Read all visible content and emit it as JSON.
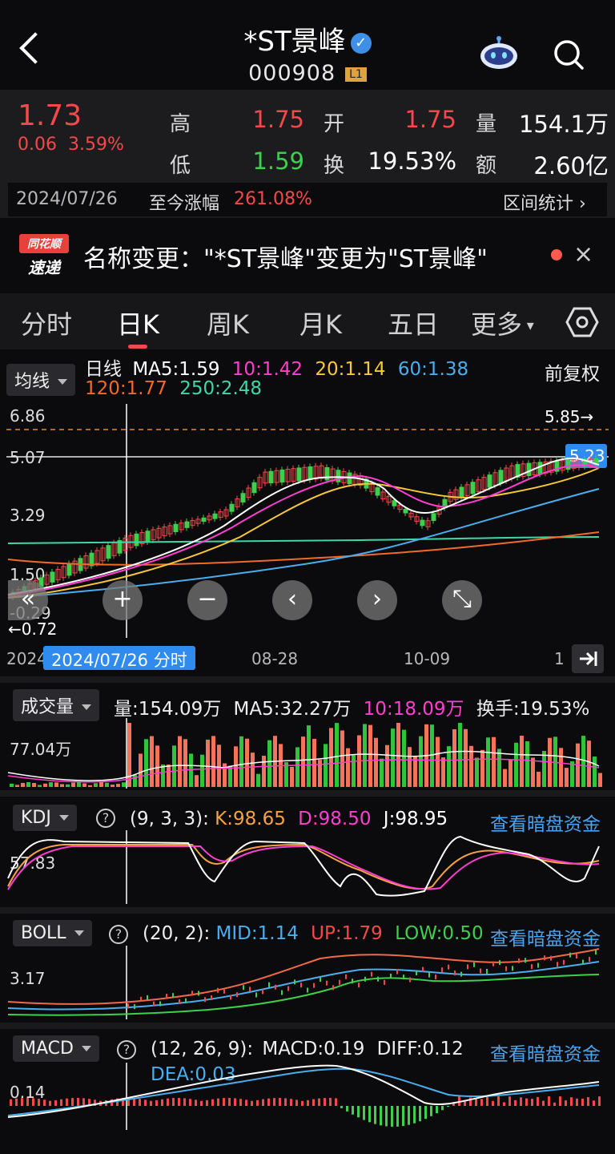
{
  "header": {
    "title": "*ST景峰",
    "code": "000908",
    "level_badge": "L1"
  },
  "quote": {
    "price": "1.73",
    "change": "0.06",
    "change_pct": "3.59%",
    "high_label": "高",
    "high": "1.75",
    "open_label": "开",
    "open": "1.75",
    "volume_label": "量",
    "volume": "154.1万",
    "low_label": "低",
    "low": "1.59",
    "turnover_label": "换",
    "turnover": "19.53%",
    "amount_label": "额",
    "amount": "2.60亿",
    "date": "2024/07/26",
    "since_label": "至今涨幅",
    "since_value": "261.08%",
    "range_stats": "区间统计"
  },
  "news": {
    "badge_top": "同花顺",
    "badge_bottom": "速递",
    "text": "名称变更：\"*ST景峰\"变更为\"ST景峰\""
  },
  "tabs": [
    "分时",
    "日K",
    "周K",
    "月K",
    "五日",
    "更多"
  ],
  "ma_panel": {
    "selector": "均线",
    "label": "日线",
    "ma5": "MA5:1.59",
    "ma10": "10:1.42",
    "ma20": "20:1.14",
    "ma60": "60:1.38",
    "ma120": "120:1.77",
    "ma250": "250:2.48",
    "adjust": "前复权",
    "y_labels": [
      "6.86",
      "5.07",
      "3.29",
      "1.50",
      "-0.29"
    ],
    "hi_marker": "5.85",
    "price_tag": "5.23",
    "lo_marker": "0.72",
    "colors": {
      "ma5": "#ffffff",
      "ma10": "#ff3fd0",
      "ma20": "#f6c83a",
      "ma60": "#4aaeee",
      "ma120": "#f06a2c",
      "ma250": "#3fd6a8"
    }
  },
  "date_axis": {
    "left_label": "2024",
    "chip": "2024/07/26 分时",
    "ticks": [
      "08-28",
      "10-09",
      "1"
    ]
  },
  "volume_panel": {
    "selector": "成交量",
    "vol": "量:154.09万",
    "ma5": "MA5:32.27万",
    "ma10": "10:18.09万",
    "turnover": "换手:19.53%",
    "y_label": "77.04万"
  },
  "kdj_panel": {
    "selector": "KDJ",
    "params": "(9, 3, 3):",
    "k": "K:98.65",
    "d": "D:98.50",
    "j": "J:98.95",
    "link": "查看暗盘资金",
    "y_label": "57.83"
  },
  "boll_panel": {
    "selector": "BOLL",
    "params": "(20, 2):",
    "mid": "MID:1.14",
    "up": "UP:1.79",
    "low": "LOW:0.50",
    "link": "查看暗盘资金",
    "y_label": "3.17"
  },
  "macd_panel": {
    "selector": "MACD",
    "params": "(12, 26, 9):",
    "macd": "MACD:0.19",
    "diff": "DIFF:0.12",
    "dea": "DEA:0.03",
    "link": "查看暗盘资金",
    "y_label": "0.14"
  }
}
